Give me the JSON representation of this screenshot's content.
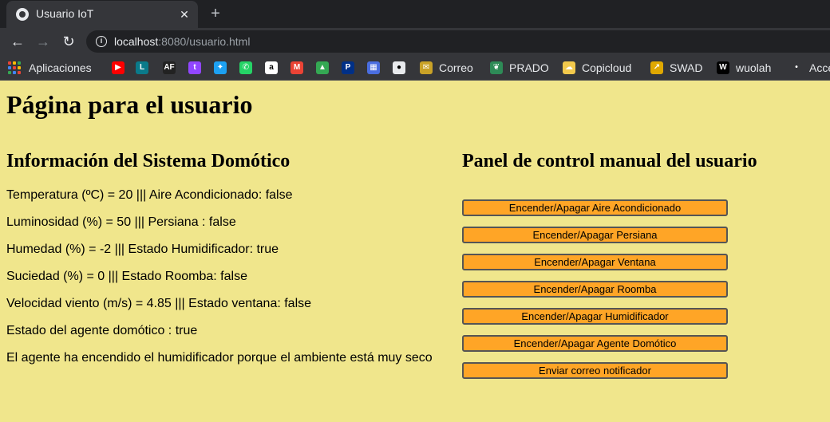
{
  "browser": {
    "tab_title": "Usuario IoT",
    "tab_close": "✕",
    "new_tab": "+",
    "url_host": "localhost",
    "url_rest": ":8080/usuario.html"
  },
  "bookmarks": [
    {
      "label": "Aplicaciones",
      "icon": "apps-grid-icon"
    },
    {
      "label": "",
      "icon": "youtube-icon",
      "color": "#ff0000",
      "glyph": "▶"
    },
    {
      "label": "",
      "icon": "league-icon",
      "color": "#0a7a8a",
      "glyph": "L"
    },
    {
      "label": "",
      "icon": "af-icon",
      "color": "#222222",
      "glyph": "AF"
    },
    {
      "label": "",
      "icon": "twitch-icon",
      "color": "#9146ff",
      "glyph": "t"
    },
    {
      "label": "",
      "icon": "twitter-icon",
      "color": "#1da1f2",
      "glyph": "✦"
    },
    {
      "label": "",
      "icon": "whatsapp-icon",
      "color": "#25d366",
      "glyph": "✆"
    },
    {
      "label": "",
      "icon": "amazon-icon",
      "color": "#ffffff",
      "glyph": "a"
    },
    {
      "label": "",
      "icon": "gmail-icon",
      "color": "#ea4335",
      "glyph": "M"
    },
    {
      "label": "",
      "icon": "drive-icon",
      "color": "#34a853",
      "glyph": "▲"
    },
    {
      "label": "",
      "icon": "paypal-icon",
      "color": "#003087",
      "glyph": "P"
    },
    {
      "label": "",
      "icon": "grid-app-icon",
      "color": "#4a6ee0",
      "glyph": "▦"
    },
    {
      "label": "",
      "icon": "github-icon",
      "color": "#e8eaed",
      "glyph": "●"
    },
    {
      "label": "Correo",
      "icon": "correo-icon",
      "color": "#c9a227",
      "glyph": "✉"
    },
    {
      "label": "PRADO",
      "icon": "prado-icon",
      "color": "#2e8b57",
      "glyph": "❦"
    },
    {
      "label": "Copicloud",
      "icon": "copicloud-icon",
      "color": "#f2c94c",
      "glyph": "☁"
    },
    {
      "label": "SWAD",
      "icon": "swad-icon",
      "color": "#e0a800",
      "glyph": "↗"
    },
    {
      "label": "wuolah",
      "icon": "wuolah-icon",
      "color": "#000000",
      "glyph": "W"
    },
    {
      "label": "Acce",
      "icon": "access-icon",
      "color": "#35363a",
      "glyph": "•"
    }
  ],
  "page": {
    "title": "Página para el usuario",
    "info_heading": "Información del Sistema Domótico",
    "control_heading": "Panel de control manual del usuario",
    "info_lines": [
      "Temperatura (ºC) = 20 ||| Aire Acondicionado: false",
      "Luminosidad (%) = 50 ||| Persiana : false",
      "Humedad (%) = -2 ||| Estado Humidificador: true",
      "Suciedad (%) = 0 ||| Estado Roomba: false",
      "Velocidad viento (m/s) = 4.85 ||| Estado ventana: false",
      "Estado del agente domótico : true",
      "El agente ha encendido el humidificador porque el ambiente está muy seco"
    ],
    "buttons": [
      "Encender/Apagar Aire Acondicionado",
      "Encender/Apagar Persiana",
      "Encender/Apagar Ventana",
      "Encender/Apagar Roomba",
      "Encender/Apagar Humidificador",
      "Encender/Apagar Agente Domótico",
      "Enviar correo notificador"
    ]
  },
  "colors": {
    "page_background": "#f0e68c",
    "button_background": "#ffa526",
    "button_border": "#555555"
  }
}
